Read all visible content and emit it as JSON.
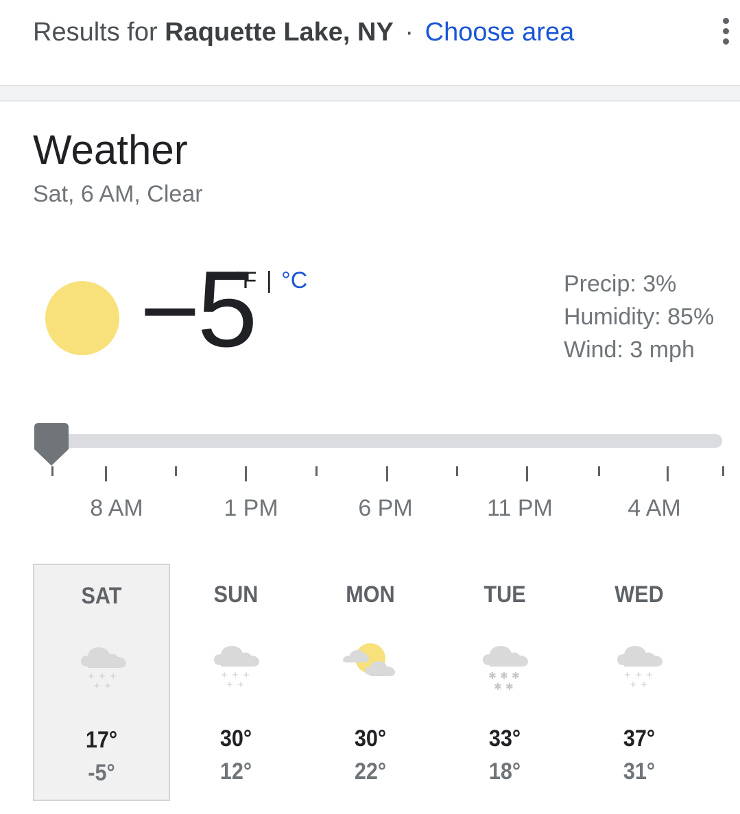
{
  "header": {
    "results_prefix": "Results for",
    "location": "Raquette Lake, NY",
    "separator": "·",
    "choose_area": "Choose area"
  },
  "weather": {
    "title": "Weather",
    "subtitle": "Sat, 6 AM, Clear",
    "current_icon": "sun-icon",
    "temperature": "-5",
    "unit_f": "°F",
    "unit_separator": "|",
    "unit_c": "°C",
    "precip": "Precip: 3%",
    "humidity": "Humidity: 85%",
    "wind": "Wind: 3 mph"
  },
  "timeline": {
    "labels": [
      "8 AM",
      "1 PM",
      "6 PM",
      "11 PM",
      "4 AM"
    ],
    "position": 0
  },
  "forecast": [
    {
      "day": "SAT",
      "icon": "cloud-snow-icon",
      "high": "17°",
      "low": "-5°",
      "selected": true
    },
    {
      "day": "SUN",
      "icon": "cloud-snow-icon",
      "high": "30°",
      "low": "12°",
      "selected": false
    },
    {
      "day": "MON",
      "icon": "partly-sunny-icon",
      "high": "30°",
      "low": "22°",
      "selected": false
    },
    {
      "day": "TUE",
      "icon": "cloud-heavy-snow-icon",
      "high": "33°",
      "low": "18°",
      "selected": false
    },
    {
      "day": "WED",
      "icon": "cloud-snow-icon",
      "high": "37°",
      "low": "31°",
      "selected": false
    }
  ],
  "colors": {
    "link": "#1a56d6",
    "sun": "#f8e17a",
    "cloud": "#d9d9d9",
    "selected_bg": "#f1f1f1"
  }
}
